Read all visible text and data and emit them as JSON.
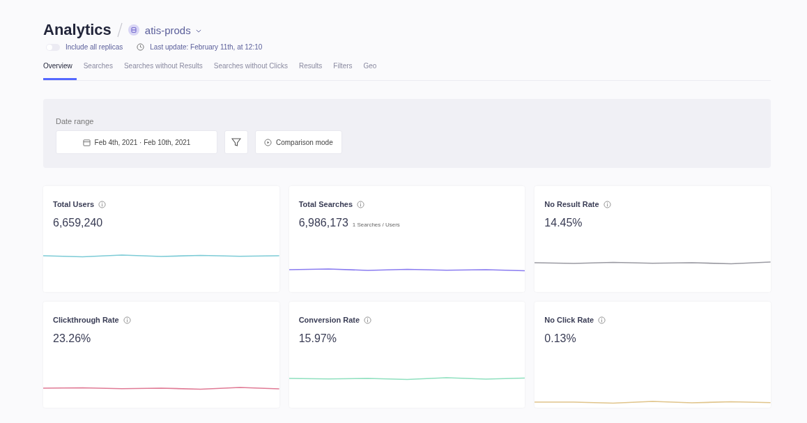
{
  "header": {
    "title": "Analytics",
    "index": "atis-prods",
    "replicas_toggle": {
      "label": "Include all replicas",
      "on": false
    },
    "last_update": "Last update: February 11th, at 12:10"
  },
  "tabs": [
    {
      "label": "Overview",
      "selected": true
    },
    {
      "label": "Searches",
      "selected": false
    },
    {
      "label": "Searches without Results",
      "selected": false
    },
    {
      "label": "Searches without Clicks",
      "selected": false
    },
    {
      "label": "Results",
      "selected": false
    },
    {
      "label": "Filters",
      "selected": false
    },
    {
      "label": "Geo",
      "selected": false
    }
  ],
  "filters": {
    "label": "Date range",
    "date_range": "Feb 4th, 2021 · Feb 10th, 2021",
    "comparison": "Comparison mode"
  },
  "cards": [
    {
      "title": "Total Users",
      "value": "6,659,240",
      "color": "#7ccbd6"
    },
    {
      "title": "Total Searches",
      "value": "6,986,173",
      "note": "1 Searches / Users",
      "color": "#8a7cf0"
    },
    {
      "title": "No Result Rate",
      "value": "14.45%",
      "color": "#9a9aa2"
    },
    {
      "title": "Clickthrough Rate",
      "value": "23.26%",
      "color": "#e07a95"
    },
    {
      "title": "Conversion Rate",
      "value": "15.97%",
      "color": "#8fe0bf"
    },
    {
      "title": "No Click Rate",
      "value": "0.13%",
      "color": "#e0c48a"
    }
  ]
}
